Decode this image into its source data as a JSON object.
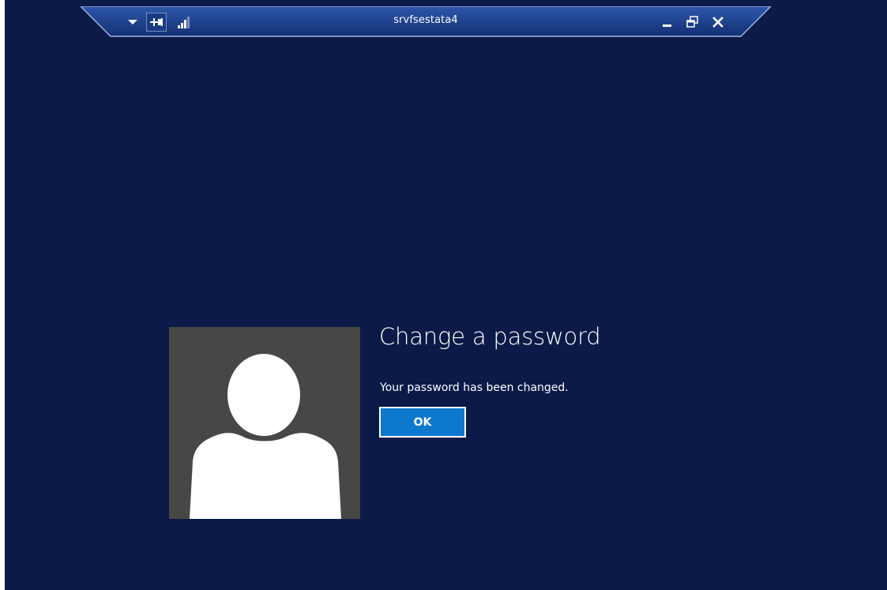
{
  "connection_bar": {
    "title": "srvfsestata4",
    "buttons": {
      "dropdown_icon": "chevron-down-icon",
      "pin_icon": "pin-icon",
      "signal_icon": "signal-strength-icon",
      "minimize_icon": "minimize-icon",
      "restore_icon": "restore-icon",
      "close_icon": "close-icon"
    }
  },
  "dialog": {
    "title": "Change a password",
    "message": "Your password has been changed.",
    "ok_label": "OK"
  },
  "user_tile": {
    "icon": "user-avatar-icon"
  },
  "colors": {
    "desktop_background": "#0b1a47",
    "bar_background": "#1b3d88",
    "tile_background": "#474747",
    "button_accent": "#0e78cd"
  }
}
